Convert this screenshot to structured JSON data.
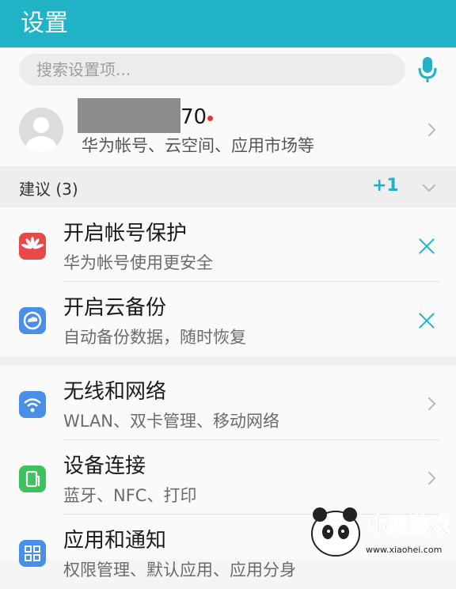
{
  "header": {
    "title": "设置"
  },
  "search": {
    "placeholder": "搜索设置项..."
  },
  "account": {
    "name_suffix": "70",
    "subtitle": "华为帐号、云空间、应用市场等"
  },
  "suggestions": {
    "title": "建议 (3)",
    "extra_count": "+1",
    "items": [
      {
        "title": "开启帐号保护",
        "subtitle": "华为帐号使用更安全",
        "icon": "huawei-logo-icon",
        "color": "#e84a47"
      },
      {
        "title": "开启云备份",
        "subtitle": "自动备份数据，随时恢复",
        "icon": "cloud-backup-icon",
        "color": "#4a8fe7"
      }
    ]
  },
  "settings": [
    {
      "title": "无线和网络",
      "subtitle": "WLAN、双卡管理、移动网络",
      "icon": "wifi-icon",
      "color": "#4a8fe7"
    },
    {
      "title": "设备连接",
      "subtitle": "蓝牙、NFC、打印",
      "icon": "device-connection-icon",
      "color": "#3ec15e"
    },
    {
      "title": "应用和通知",
      "subtitle": "权限管理、默认应用、应用分身",
      "icon": "apps-grid-icon",
      "color": "#4a8fe7"
    }
  ],
  "watermark": {
    "brand": "小黑游戏",
    "url": "www.xiaohei.com"
  },
  "colors": {
    "accent": "#1fb3c5",
    "close": "#1fb3c5"
  }
}
